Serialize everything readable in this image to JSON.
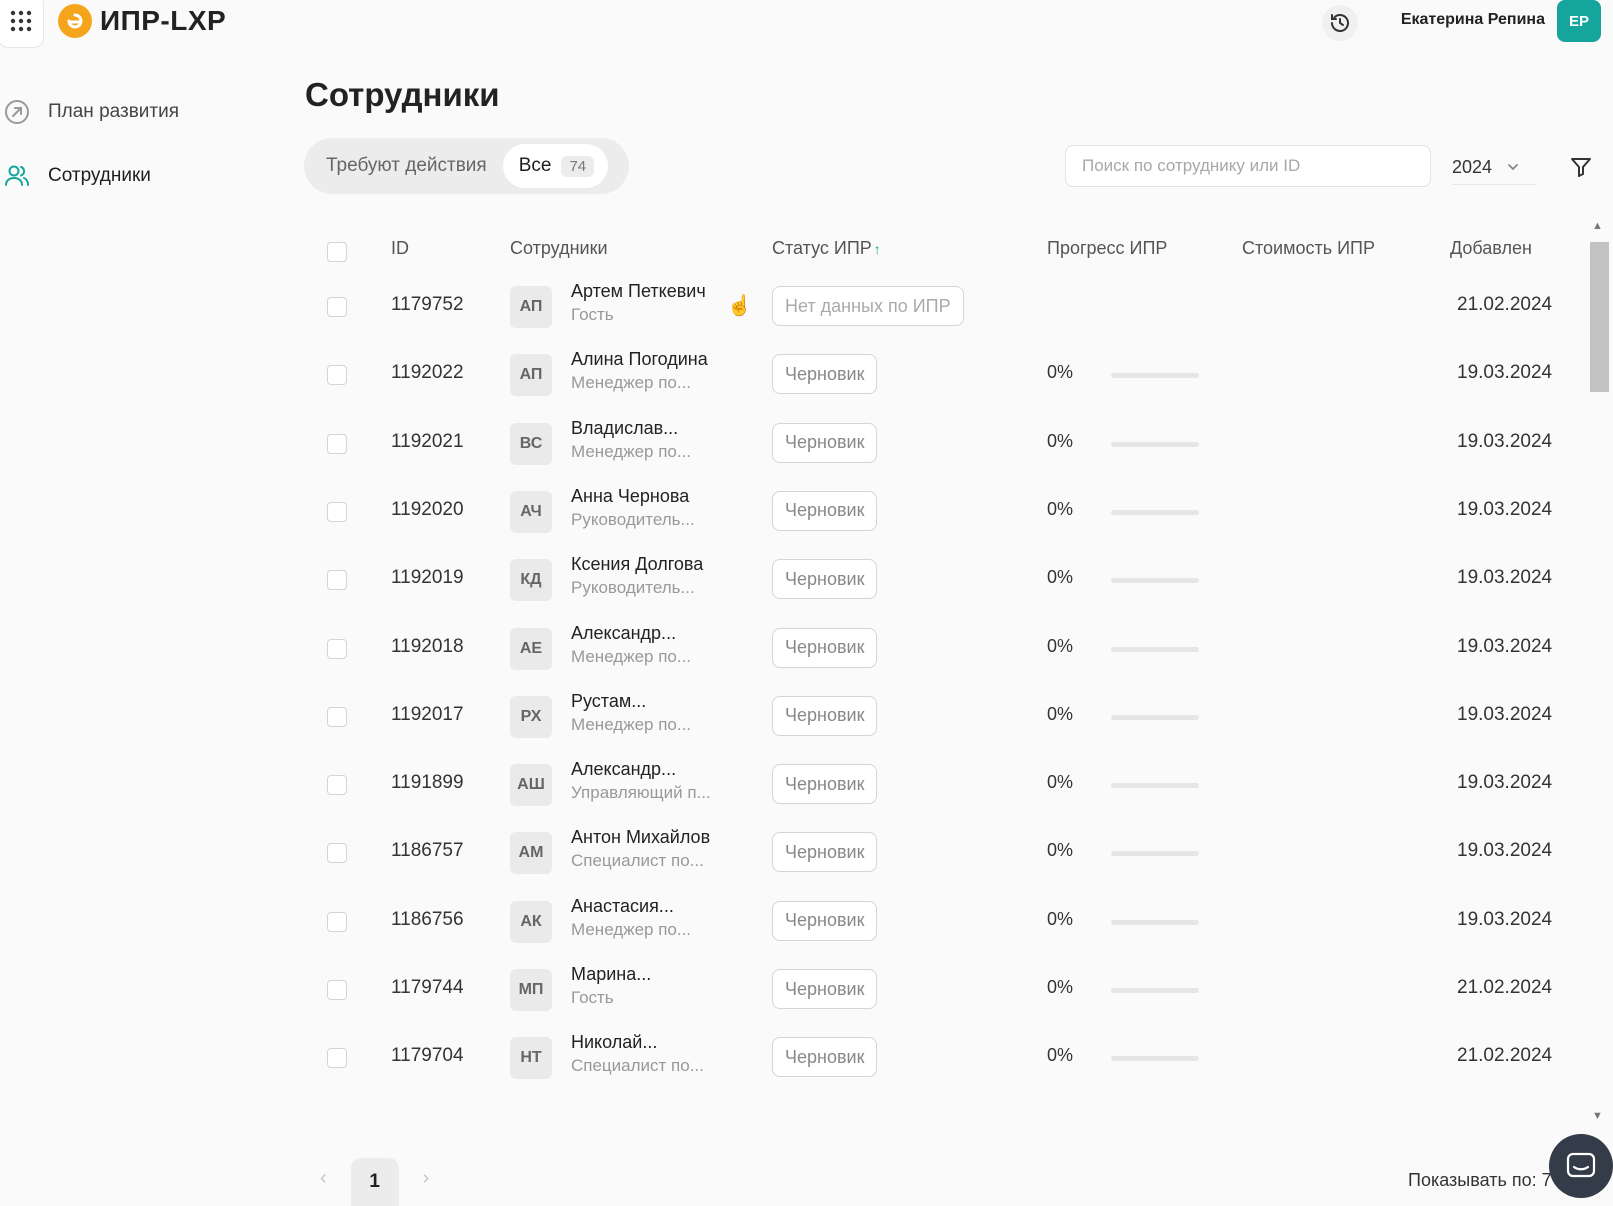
{
  "app": {
    "title": "ИПР-LXP"
  },
  "user": {
    "name": "Екатерина Репина",
    "initials": "ЕР"
  },
  "sidebar": {
    "items": [
      {
        "label": "План развития",
        "icon": "arrow-up-right-icon",
        "active": false
      },
      {
        "label": "Сотрудники",
        "icon": "users-icon",
        "active": true
      }
    ]
  },
  "page": {
    "title": "Сотрудники"
  },
  "tabs": {
    "requires_action": "Требуют действия",
    "all": "Все",
    "all_count": "74"
  },
  "search": {
    "placeholder": "Поиск по сотруднику или ID",
    "value": ""
  },
  "year": {
    "selected": "2024"
  },
  "table": {
    "headers": {
      "id": "ID",
      "employee": "Сотрудники",
      "status": "Статус ИПР",
      "status_sort": "↑",
      "progress": "Прогресс ИПР",
      "cost": "Стоимость ИПР",
      "added": "Добавлен"
    },
    "rows": [
      {
        "id": "1179752",
        "initials": "АП",
        "name": "Артем Петкевич",
        "role": "Гость",
        "status": "Нет данных по ИПР",
        "progress": "",
        "progress_value": null,
        "date": "21.02.2024"
      },
      {
        "id": "1192022",
        "initials": "АП",
        "name": "Алина Погодина",
        "role": "Менеджер по...",
        "status": "Черновик",
        "progress": "0%",
        "progress_value": 0,
        "date": "19.03.2024"
      },
      {
        "id": "1192021",
        "initials": "ВС",
        "name": "Владислав...",
        "role": "Менеджер по...",
        "status": "Черновик",
        "progress": "0%",
        "progress_value": 0,
        "date": "19.03.2024"
      },
      {
        "id": "1192020",
        "initials": "АЧ",
        "name": "Анна Чернова",
        "role": "Руководитель...",
        "status": "Черновик",
        "progress": "0%",
        "progress_value": 0,
        "date": "19.03.2024"
      },
      {
        "id": "1192019",
        "initials": "КД",
        "name": "Ксения Долгова",
        "role": "Руководитель...",
        "status": "Черновик",
        "progress": "0%",
        "progress_value": 0,
        "date": "19.03.2024"
      },
      {
        "id": "1192018",
        "initials": "АЕ",
        "name": "Александр...",
        "role": "Менеджер по...",
        "status": "Черновик",
        "progress": "0%",
        "progress_value": 0,
        "date": "19.03.2024"
      },
      {
        "id": "1192017",
        "initials": "РХ",
        "name": "Рустам...",
        "role": "Менеджер по...",
        "status": "Черновик",
        "progress": "0%",
        "progress_value": 0,
        "date": "19.03.2024"
      },
      {
        "id": "1191899",
        "initials": "АШ",
        "name": "Александр...",
        "role": "Управляющий п...",
        "status": "Черновик",
        "progress": "0%",
        "progress_value": 0,
        "date": "19.03.2024"
      },
      {
        "id": "1186757",
        "initials": "АМ",
        "name": "Антон Михайлов",
        "role": "Специалист по...",
        "status": "Черновик",
        "progress": "0%",
        "progress_value": 0,
        "date": "19.03.2024"
      },
      {
        "id": "1186756",
        "initials": "АК",
        "name": "Анастасия...",
        "role": "Менеджер по...",
        "status": "Черновик",
        "progress": "0%",
        "progress_value": 0,
        "date": "19.03.2024"
      },
      {
        "id": "1179744",
        "initials": "МП",
        "name": "Марина...",
        "role": "Гость",
        "status": "Черновик",
        "progress": "0%",
        "progress_value": 0,
        "date": "21.02.2024"
      },
      {
        "id": "1179704",
        "initials": "НТ",
        "name": "Николай...",
        "role": "Специалист по...",
        "status": "Черновик",
        "progress": "0%",
        "progress_value": 0,
        "date": "21.02.2024"
      }
    ]
  },
  "pagination": {
    "current": "1",
    "prev": "‹",
    "next": "›",
    "per_page_label": "Показывать по: 7"
  },
  "colors": {
    "accent": "#16a59d",
    "logo": "#f5a51b"
  }
}
